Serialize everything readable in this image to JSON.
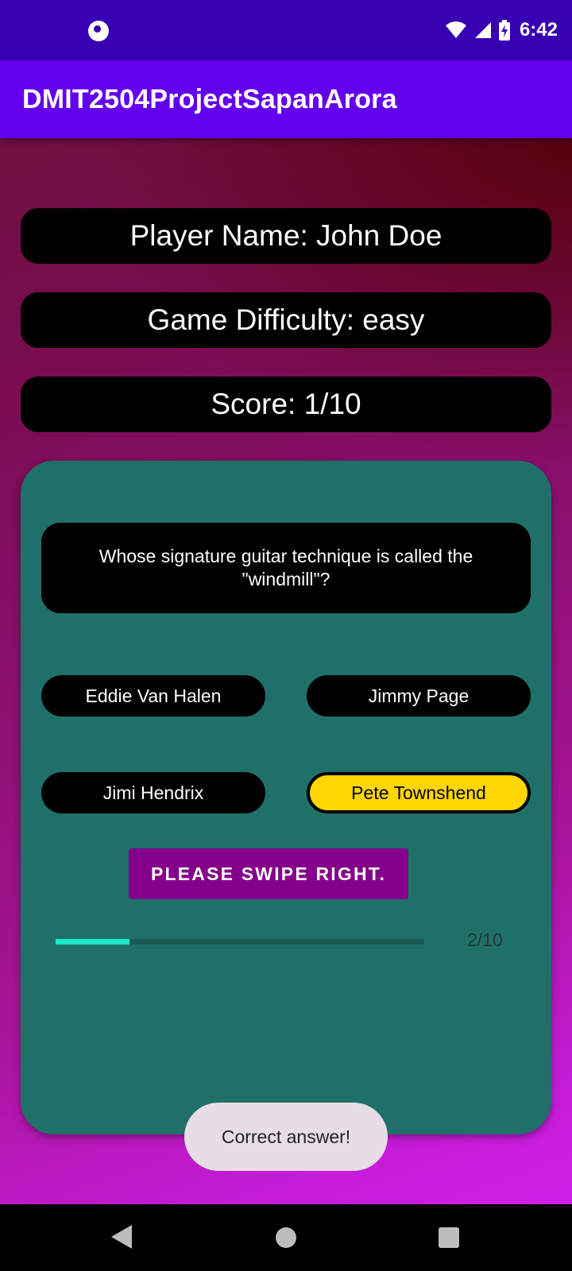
{
  "status_bar": {
    "time": "6:42",
    "icons": [
      "app-notification-icon",
      "wifi-icon",
      "cellular-signal-icon",
      "battery-charging-icon"
    ]
  },
  "app_bar": {
    "title": "DMIT2504ProjectSapanArora"
  },
  "info": {
    "player_name": "Player Name: John Doe",
    "difficulty": "Game Difficulty: easy",
    "score": "Score: 1/10"
  },
  "quiz": {
    "question": "Whose signature guitar technique is called the \"windmill\"?",
    "answers": [
      "Eddie Van Halen",
      "Jimmy Page",
      "Jimi Hendrix",
      "Pete Townshend"
    ],
    "selected_answer": "Pete Townshend",
    "swipe_button": "PLEASE SWIPE RIGHT.",
    "progress_label": "2/10",
    "progress_fraction": 0.2
  },
  "toast": {
    "message": "Correct answer!"
  },
  "colors": {
    "status_bar": "#3700b3",
    "app_bar": "#6200ee",
    "card": "#20706a",
    "selected_answer": "#ffd600",
    "swipe_button": "#84008a",
    "progress": "#1de9c8"
  },
  "nav_bar": {
    "icons": [
      "back-icon",
      "home-icon",
      "recents-icon"
    ]
  }
}
